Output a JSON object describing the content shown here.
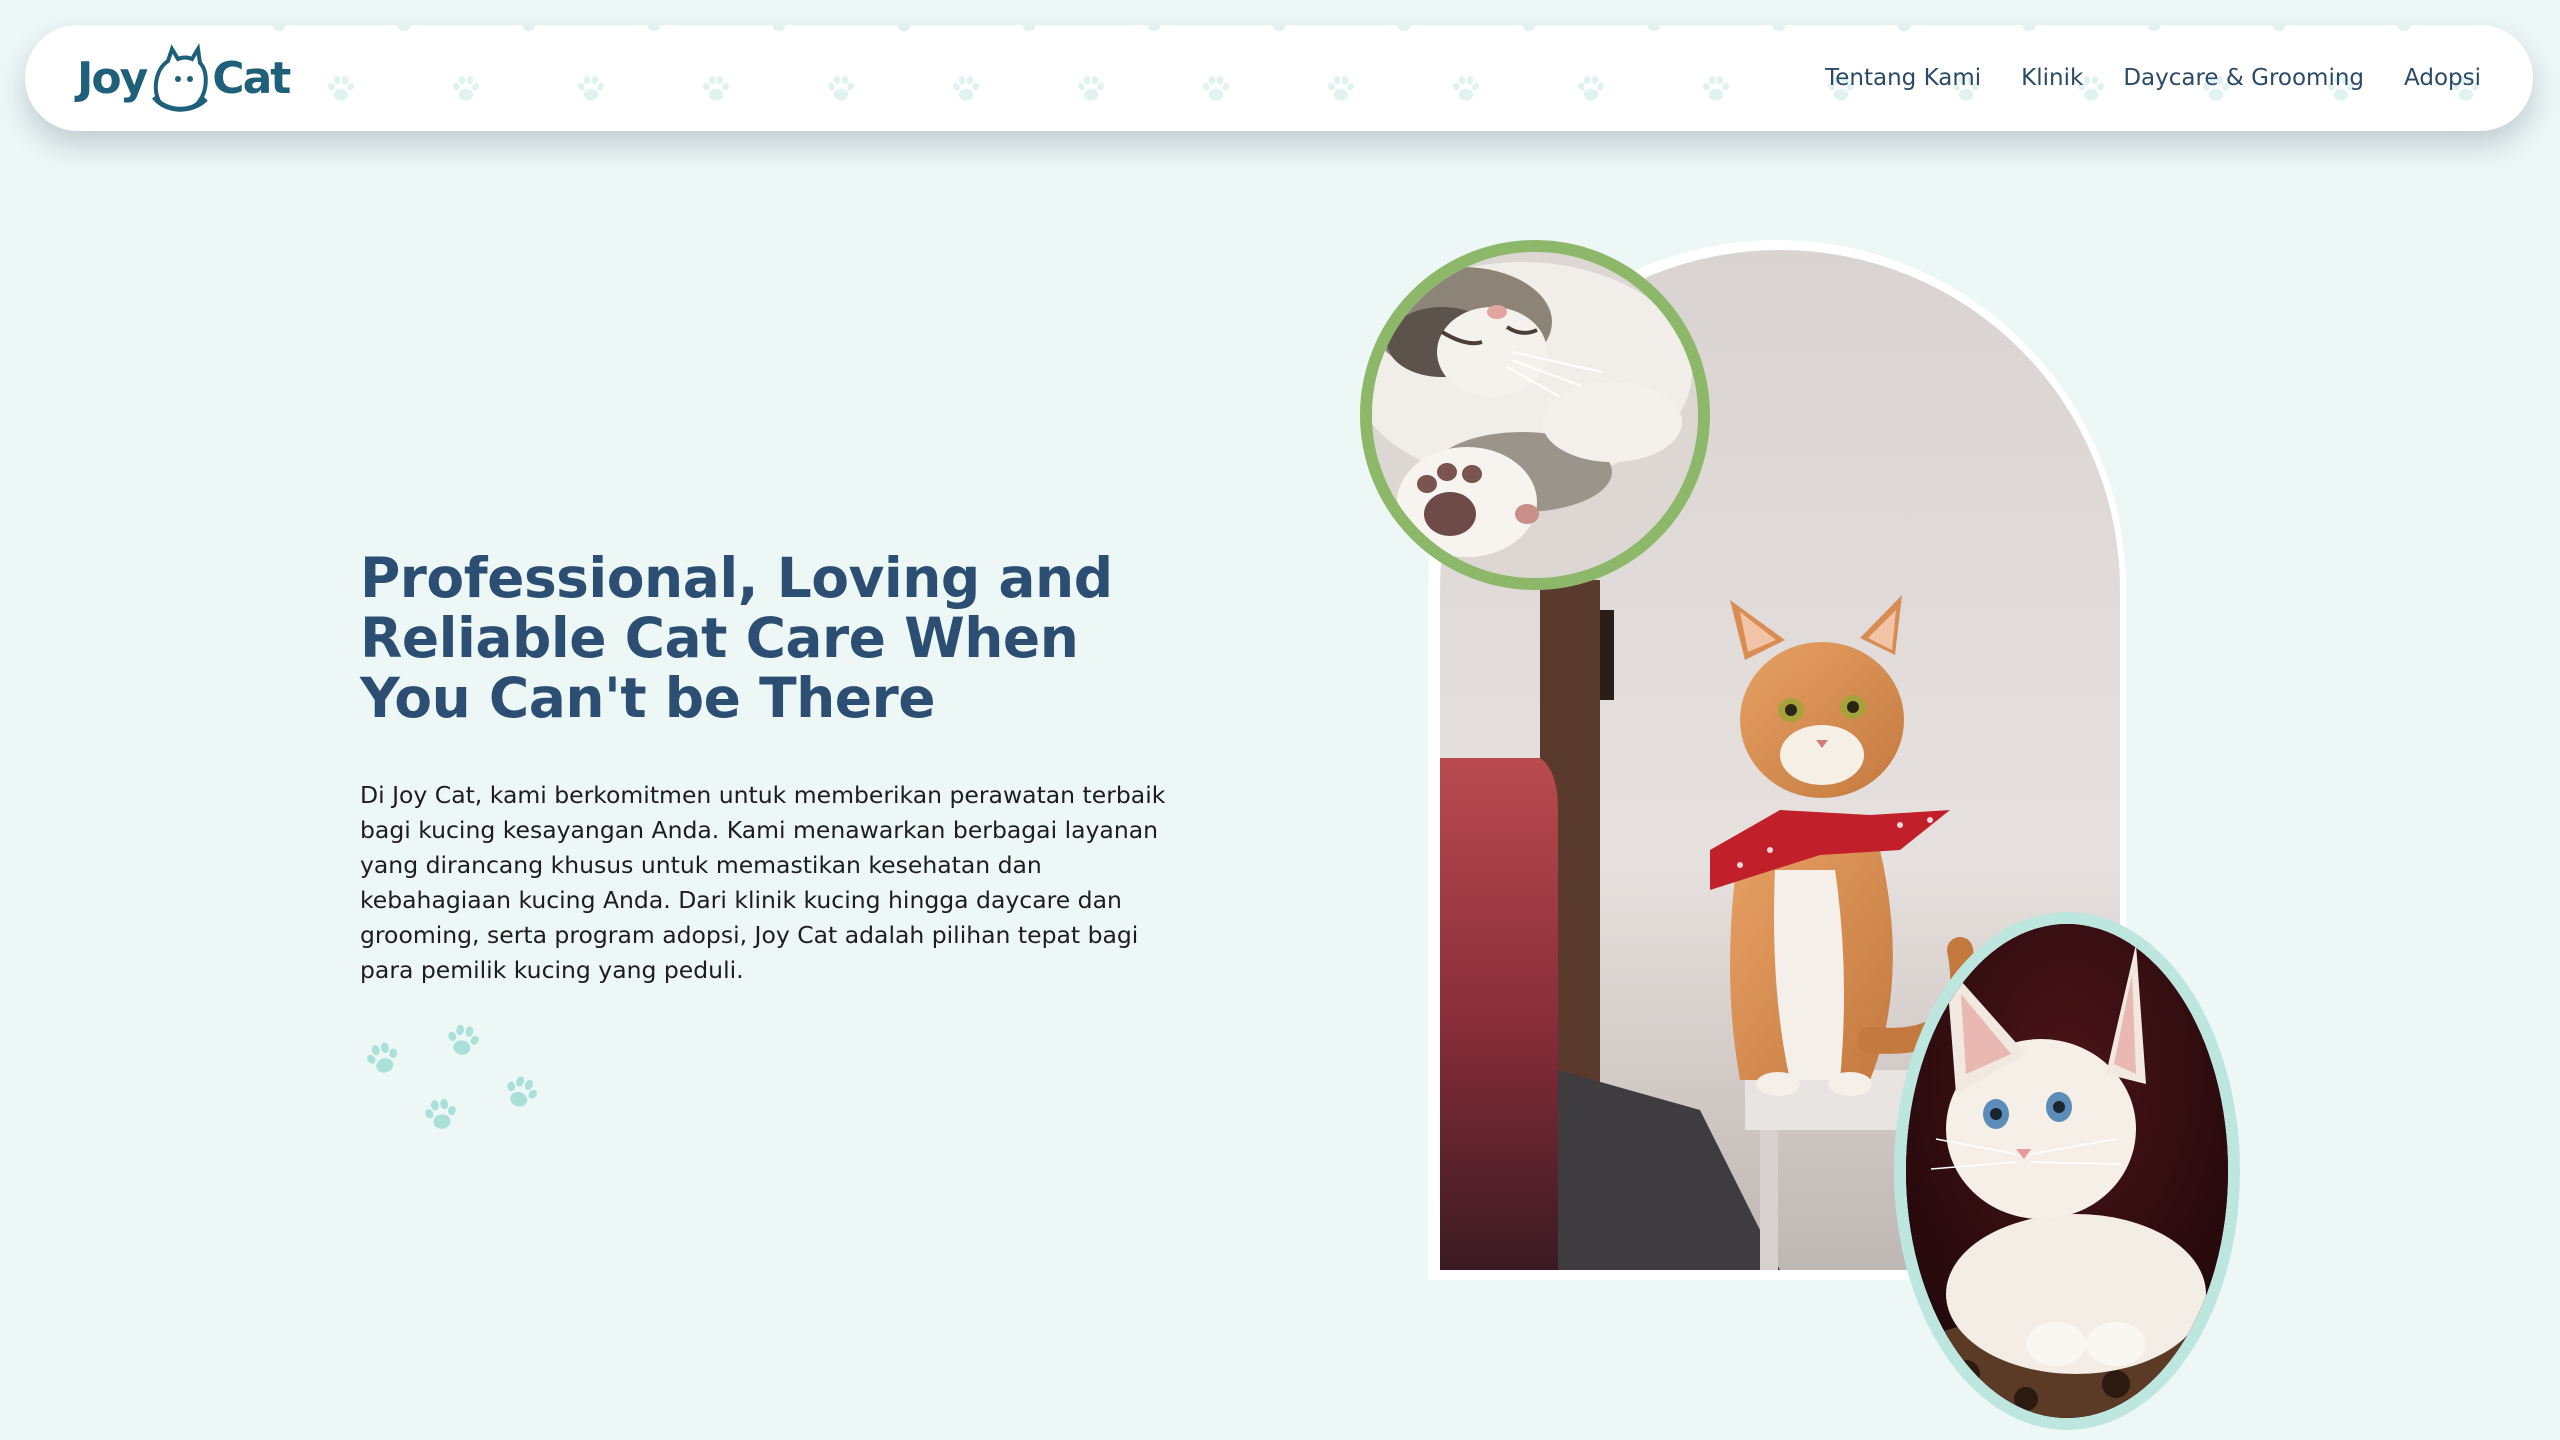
{
  "brand": {
    "name_part1": "Joy",
    "name_part2": "Cat",
    "primary_color": "#1e5f7a",
    "accent_color": "#8db86a",
    "background_color": "#ecf7f6"
  },
  "nav": {
    "links": [
      {
        "label": "Tentang Kami"
      },
      {
        "label": "Klinik"
      },
      {
        "label": "Daycare & Grooming"
      },
      {
        "label": "Adopsi"
      }
    ]
  },
  "hero": {
    "title": "Professional, Loving and Reliable Cat Care When You Can't be There",
    "description": "Di Joy Cat, kami berkomitmen untuk memberikan perawatan terbaik bagi kucing kesayangan Anda. Kami menawarkan berbagai layanan yang dirancang khusus untuk memastikan kesehatan dan kebahagiaan kucing Anda. Dari klinik kucing hingga daycare dan grooming, serta program adopsi, Joy Cat adalah pilihan tepat bagi para pemilik kucing yang peduli.",
    "decor_icon": "paw-print-icon",
    "images": [
      {
        "name": "sleeping-kitten-photo",
        "frame": "circle"
      },
      {
        "name": "orange-cat-with-bandana-photo",
        "frame": "arch"
      },
      {
        "name": "white-kitten-photo",
        "frame": "oval"
      }
    ]
  }
}
